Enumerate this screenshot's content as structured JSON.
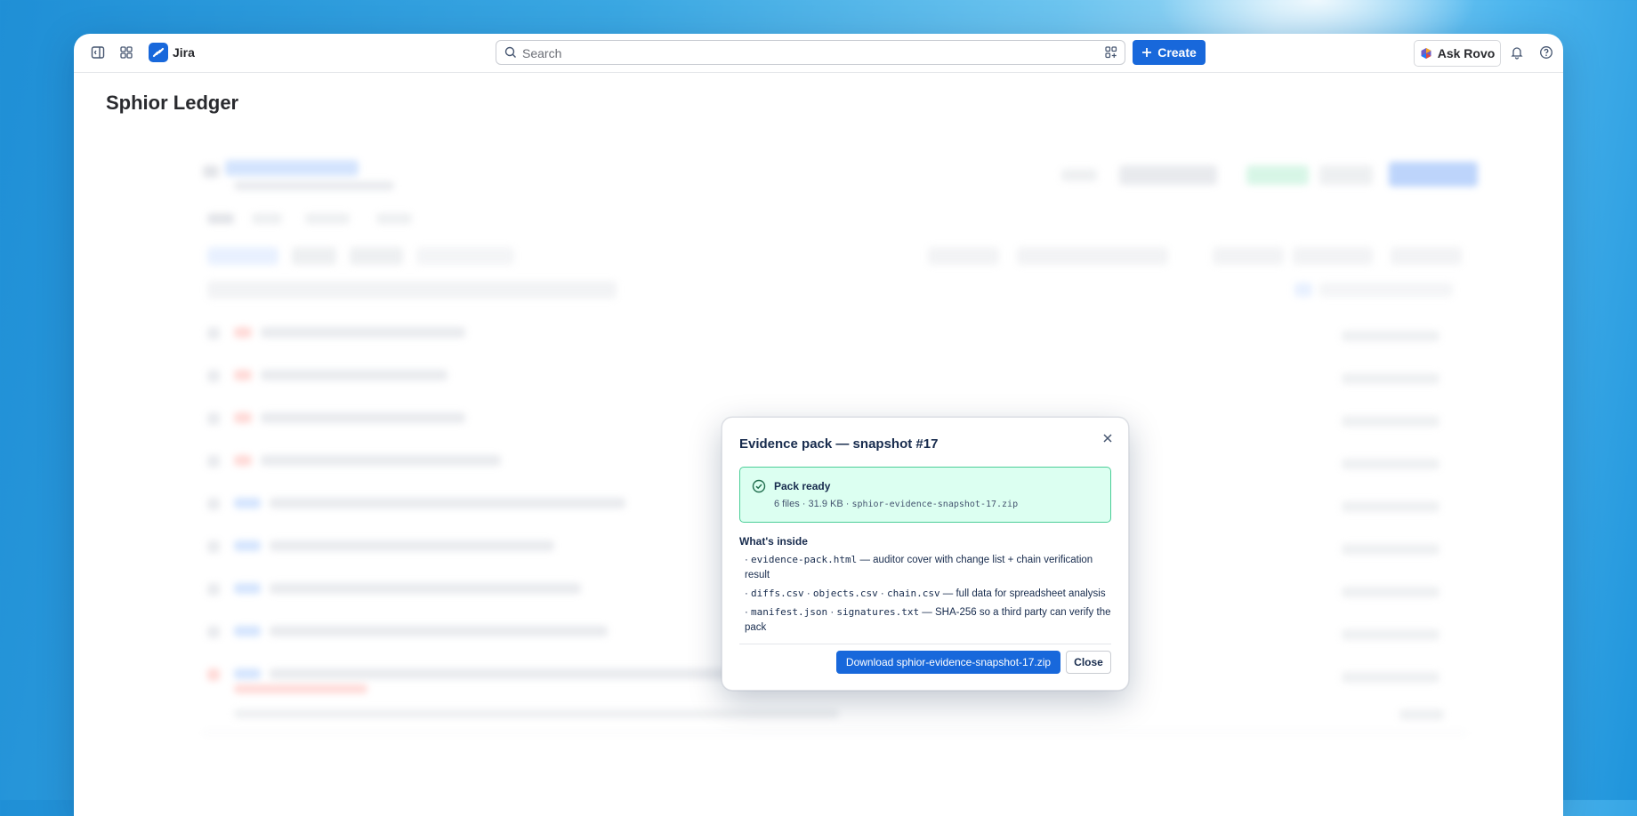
{
  "app": {
    "name": "Jira",
    "search_placeholder": "Search",
    "create_label": "Create",
    "ask_rovo_label": "Ask Rovo"
  },
  "page": {
    "title": "Sphior Ledger"
  },
  "modal": {
    "title": "Evidence pack — snapshot #17",
    "status": {
      "title": "Pack ready",
      "files": "6 files",
      "size": "31.9 KB",
      "filename": "sphior-evidence-snapshot-17.zip"
    },
    "inside_heading": "What's inside",
    "items": [
      {
        "codes": [
          "evidence-pack.html"
        ],
        "desc": "— auditor cover with change list + chain verification result"
      },
      {
        "codes": [
          "diffs.csv",
          "objects.csv",
          "chain.csv"
        ],
        "desc": "— full data for spreadsheet analysis"
      },
      {
        "codes": [
          "manifest.json",
          "signatures.txt"
        ],
        "desc": "— SHA-256 so a third party can verify the pack"
      }
    ],
    "download_label": "Download sphior-evidence-snapshot-17.zip",
    "close_label": "Close"
  },
  "colors": {
    "primary": "#1868db",
    "success_border": "#4bce97",
    "success_bg": "#dcfff1"
  }
}
